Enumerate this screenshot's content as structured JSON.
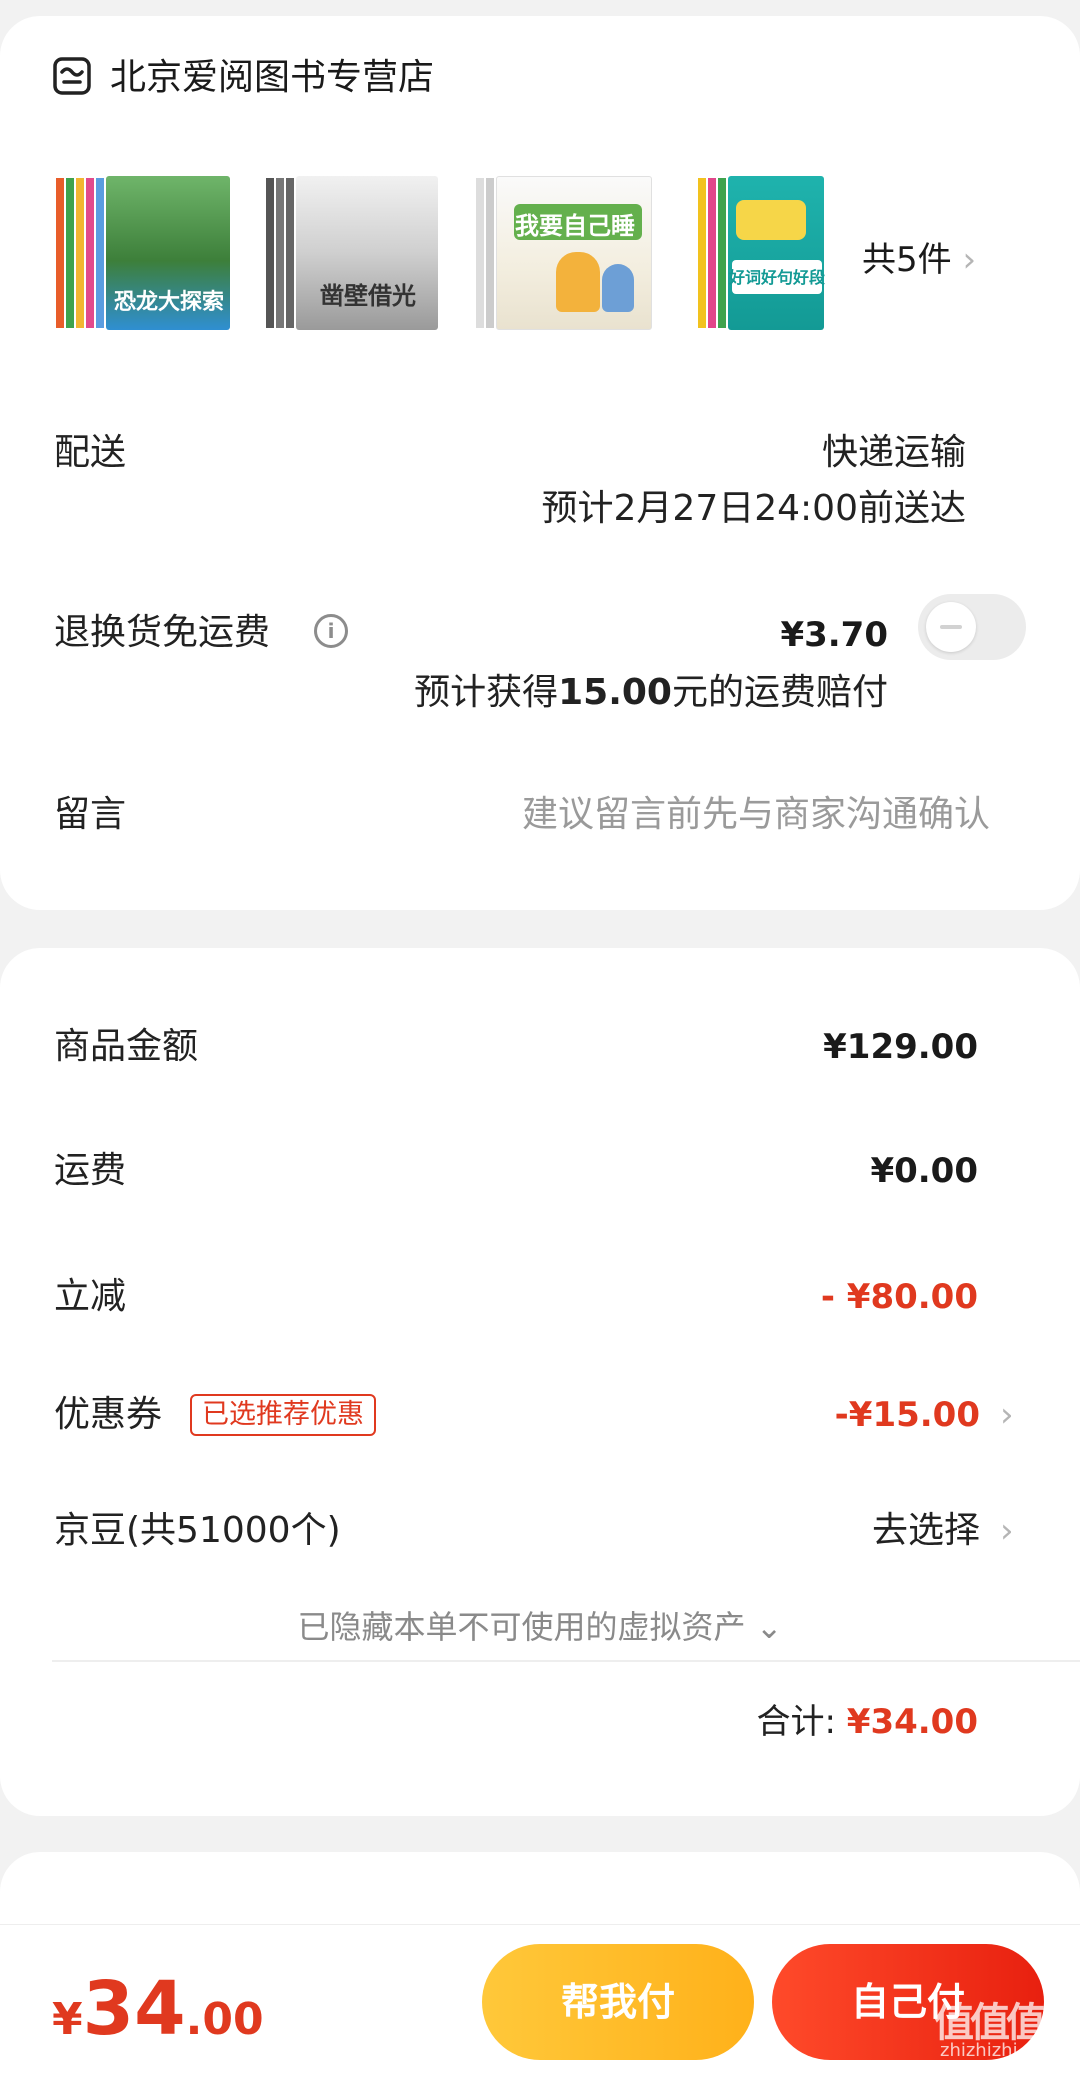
{
  "store": {
    "name": "北京爱阅图书专营店",
    "item_count": "共5件",
    "products": [
      {
        "caption": "恐龙大探索",
        "color": "#2f8fd2"
      },
      {
        "caption": "凿壁借光",
        "color": "#9a9a9a"
      },
      {
        "caption": "我要自己睡",
        "color": "#64b04d"
      },
      {
        "caption": "好词好句好段",
        "color": "#1aa7a0"
      }
    ]
  },
  "delivery": {
    "label": "配送",
    "method": "快递运输",
    "eta": "预计2月27日24:00前送达"
  },
  "return_insurance": {
    "label": "退换货免运费",
    "info_icon": "i",
    "price": "¥3.70",
    "note_prefix": "预计获得",
    "note_amount": "15.00",
    "note_suffix": "元的运费赔付",
    "toggle_on": false
  },
  "message": {
    "label": "留言",
    "placeholder": "建议留言前先与商家沟通确认"
  },
  "pricing": {
    "goods_label": "商品金额",
    "goods_value": "¥129.00",
    "shipping_label": "运费",
    "shipping_value": "¥0.00",
    "discount_label": "立减",
    "discount_value": "- ¥80.00",
    "coupon_label": "优惠券",
    "coupon_tag": "已选推荐优惠",
    "coupon_value": "-¥15.00",
    "beans_label": "京豆(共51000个)",
    "beans_action": "去选择",
    "hidden_assets": "已隐藏本单不可使用的虚拟资产",
    "total_label": "合计:",
    "total_value": "¥34.00"
  },
  "footer": {
    "currency": "¥",
    "price_int": "34",
    "price_dec": ".00",
    "help_pay": "帮我付",
    "self_pay": "自己付"
  },
  "watermark": {
    "main": "值值值",
    "sub": "zhizhizhi.com"
  },
  "colors": {
    "accent_red": "#e0391f",
    "help_button": "#ffb11a",
    "self_button": "#e8200f"
  }
}
